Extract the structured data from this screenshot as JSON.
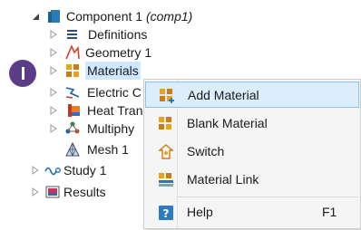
{
  "tree": {
    "component": {
      "label": "Component 1 ",
      "tag": "(comp1)"
    },
    "definitions": "Definitions",
    "geometry": "Geometry 1",
    "materials": "Materials",
    "electric": "Electric C",
    "heat": "Heat Tran",
    "multiphysics": "Multiphy",
    "mesh": "Mesh 1",
    "study": "Study 1",
    "results": "Results"
  },
  "context_menu": {
    "items": [
      {
        "label": "Add Material",
        "icon": "add-material-icon"
      },
      {
        "label": "Blank Material",
        "icon": "blank-material-icon"
      },
      {
        "label": "Switch",
        "icon": "switch-icon"
      },
      {
        "label": "Material Link",
        "icon": "material-link-icon"
      },
      {
        "label": "Help",
        "shortcut": "F1",
        "icon": "help-icon"
      }
    ]
  },
  "colors": {
    "selection": "#cde8ff",
    "menu_highlight": "#dbeefd",
    "step_badge": "#5b3c87"
  }
}
